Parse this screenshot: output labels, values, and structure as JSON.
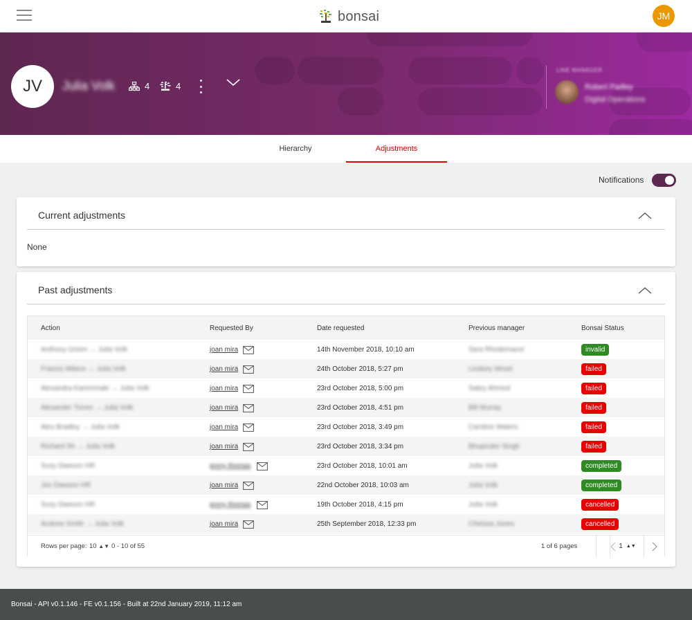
{
  "app": {
    "name": "bonsai",
    "user_initials": "JM",
    "colors": {
      "brand": "#5e2750",
      "accent_red": "#e60000",
      "status_green": "#2e8b23",
      "avatar": "#eb9700"
    }
  },
  "profile": {
    "initials": "JV",
    "name": "Julia Volk",
    "direct_reports": "4",
    "hierarchy_count": "4",
    "manager_label": "LINE MANAGER",
    "manager_name": "Robert Padley",
    "manager_title": "Digital Operations"
  },
  "tabs": [
    {
      "label": "Hierarchy",
      "active": false
    },
    {
      "label": "Adjustments",
      "active": true
    }
  ],
  "notifications": {
    "label": "Notifications",
    "enabled": true
  },
  "current_adjustments": {
    "title": "Current adjustments",
    "empty_text": "None"
  },
  "past_adjustments": {
    "title": "Past adjustments",
    "columns": [
      "Action",
      "Requested By",
      "Date requested",
      "Previous manager",
      "Bonsai Status"
    ],
    "rows": [
      {
        "action": "Anthony Green → Julia Volk",
        "requested_by": "joan mira",
        "date": "14th November 2018, 10:10 am",
        "previous_manager": "Sara Rhodemacer",
        "status": "invalid",
        "status_color": "green",
        "blur_requester": false
      },
      {
        "action": "Francis Milano → Julia Volk",
        "requested_by": "joan mira",
        "date": "24th October 2018, 5:27 pm",
        "previous_manager": "Lindsey Wood",
        "status": "failed",
        "status_color": "red",
        "blur_requester": false
      },
      {
        "action": "Alexandra Karemmale → Julia Volk",
        "requested_by": "joan mira",
        "date": "23rd October 2018, 5:00 pm",
        "previous_manager": "Sabry Ahmed",
        "status": "failed",
        "status_color": "red",
        "blur_requester": false
      },
      {
        "action": "Alexander Torres → Julia Volk",
        "requested_by": "joan mira",
        "date": "23rd October 2018, 4:51 pm",
        "previous_manager": "Bill Murray",
        "status": "failed",
        "status_color": "red",
        "blur_requester": false
      },
      {
        "action": "Alex Bradley → Julia Volk",
        "requested_by": "joan mira",
        "date": "23rd October 2018, 3:49 pm",
        "previous_manager": "Caroline Waters",
        "status": "failed",
        "status_color": "red",
        "blur_requester": false
      },
      {
        "action": "Richard Sh → Julia Volk",
        "requested_by": "joan mira",
        "date": "23rd October 2018, 3:34 pm",
        "previous_manager": "Bhupinder Singh",
        "status": "failed",
        "status_color": "red",
        "blur_requester": false
      },
      {
        "action": "Suzy Dawson HR",
        "requested_by": "jenny thomas",
        "date": "23rd October 2018, 10:01 am",
        "previous_manager": "Julia Volk",
        "status": "completed",
        "status_color": "green",
        "blur_requester": true
      },
      {
        "action": "Jon Dawson HR",
        "requested_by": "joan mira",
        "date": "22nd October 2018, 10:03 am",
        "previous_manager": "Julia Volk",
        "status": "completed",
        "status_color": "green",
        "blur_requester": false
      },
      {
        "action": "Suzy Dawson HR",
        "requested_by": "jenny thomas",
        "date": "19th October 2018, 4:15 pm",
        "previous_manager": "Julia Volk",
        "status": "cancelled",
        "status_color": "red",
        "blur_requester": true
      },
      {
        "action": "Andrew Smith → Julia Volk",
        "requested_by": "joan mira",
        "date": "25th September 2018, 12:33 pm",
        "previous_manager": "Chelsea Jones",
        "status": "cancelled",
        "status_color": "red",
        "blur_requester": false
      }
    ],
    "pagination": {
      "rows_per_page_label": "Rows per page:",
      "rows_per_page": "10",
      "range": "0 - 10 of 55",
      "page_summary": "1 of 6 pages",
      "current_page": "1"
    }
  },
  "footer": {
    "text": "Bonsai - API v0.1.146 - FE v0.1.156 - Built at 22nd January 2019, 11:12 am"
  }
}
